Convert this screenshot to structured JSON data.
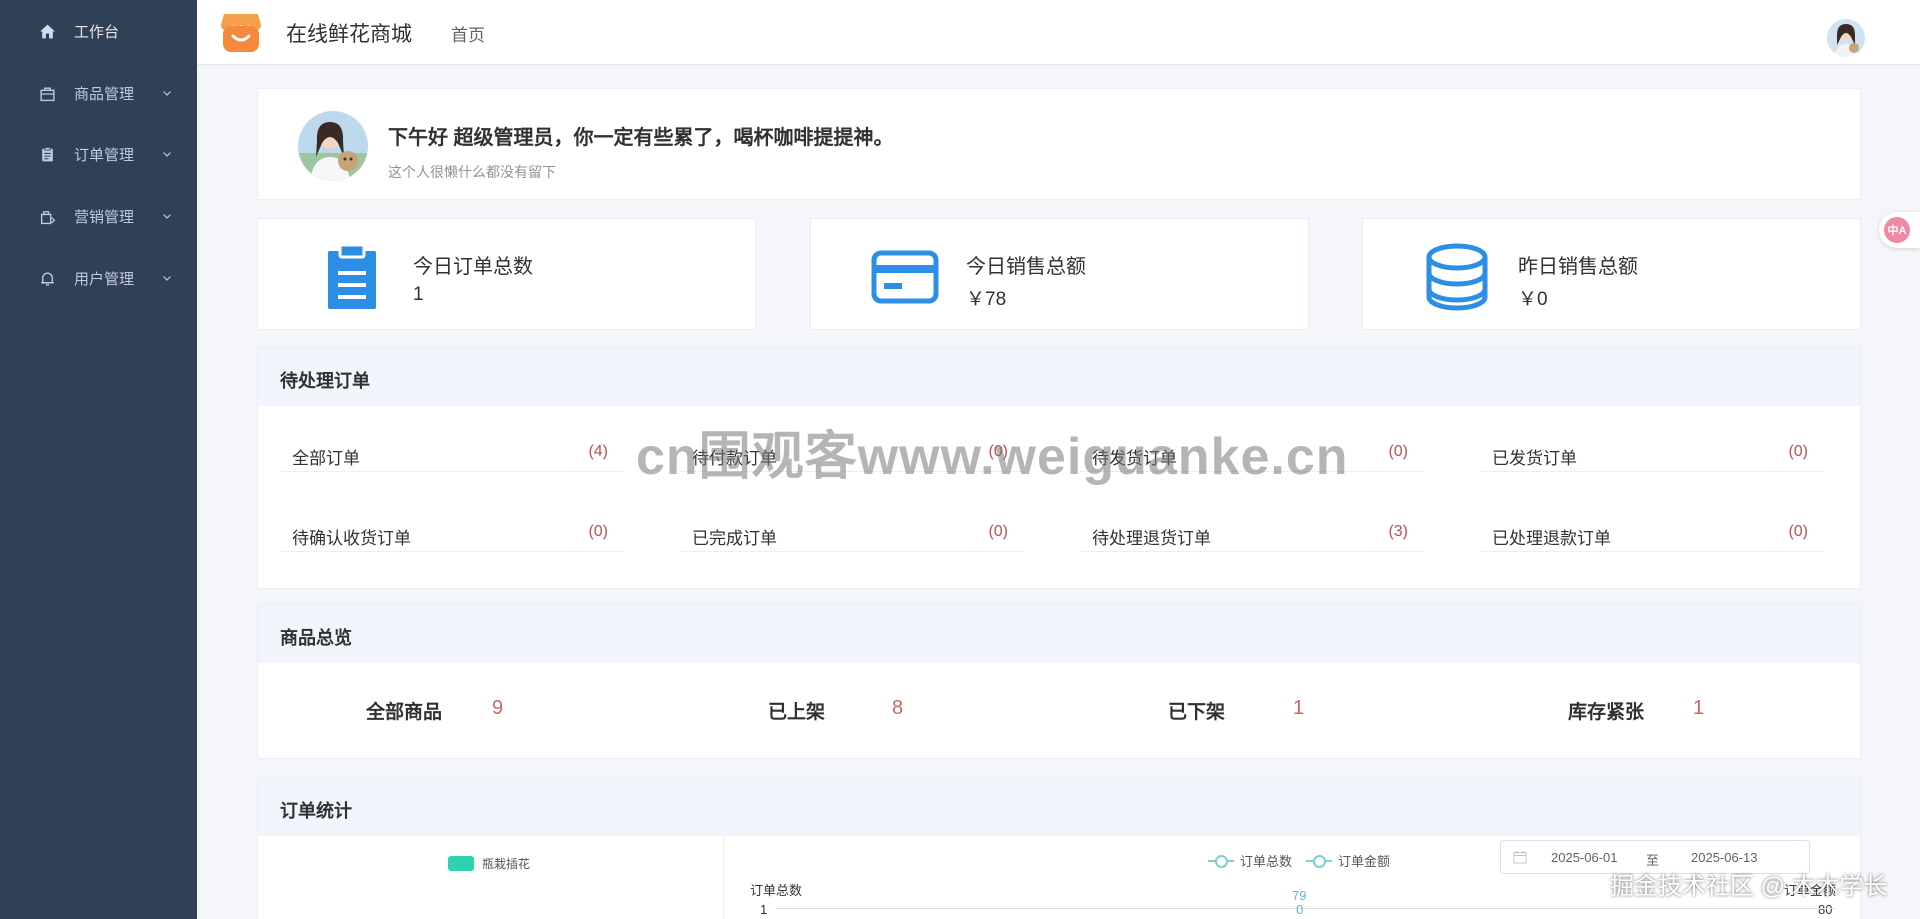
{
  "sidebar": {
    "items": [
      {
        "label": "工作台",
        "icon": "home-icon",
        "active": true
      },
      {
        "label": "商品管理",
        "icon": "bag-icon"
      },
      {
        "label": "订单管理",
        "icon": "clipboard-icon"
      },
      {
        "label": "营销管理",
        "icon": "gift-icon"
      },
      {
        "label": "用户管理",
        "icon": "bell-icon"
      }
    ]
  },
  "header": {
    "brand": "在线鲜花商城",
    "nav_home": "首页"
  },
  "welcome": {
    "title": "下午好 超级管理员，你一定有些累了，喝杯咖啡提提神。",
    "subtitle": "这个人很懒什么都没有留下"
  },
  "stats": [
    {
      "label": "今日订单总数",
      "value": "1",
      "icon": "clipboard-icon"
    },
    {
      "label": "今日销售总额",
      "value": "￥78",
      "icon": "card-icon"
    },
    {
      "label": "昨日销售总额",
      "value": "￥0",
      "icon": "coins-icon"
    }
  ],
  "pending": {
    "title": "待处理订单",
    "items": [
      {
        "label": "全部订单",
        "count": "(4)"
      },
      {
        "label": "待付款订单",
        "count": "(0)"
      },
      {
        "label": "待发货订单",
        "count": "(0)"
      },
      {
        "label": "已发货订单",
        "count": "(0)"
      },
      {
        "label": "待确认收货订单",
        "count": "(0)"
      },
      {
        "label": "已完成订单",
        "count": "(0)"
      },
      {
        "label": "待处理退货订单",
        "count": "(3)"
      },
      {
        "label": "已处理退款订单",
        "count": "(0)"
      }
    ]
  },
  "overview": {
    "title": "商品总览",
    "items": [
      {
        "label": "全部商品",
        "value": "9"
      },
      {
        "label": "已上架",
        "value": "8"
      },
      {
        "label": "已下架",
        "value": "1"
      },
      {
        "label": "库存紧张",
        "value": "1"
      }
    ]
  },
  "order_stats": {
    "title": "订单统计",
    "pie_legend": "瓶栽插花",
    "legend_total": "订单总数",
    "legend_amount": "订单金额",
    "date_start": "2025-06-01",
    "date_sep": "至",
    "date_end": "2025-06-13",
    "y_left_label": "订单总数",
    "y_left_tick": "1",
    "y_right_label": "订单金额",
    "y_right_tick": "80",
    "point_label_1": "79",
    "point_label_2": "0"
  },
  "watermark": "cn围观客www.weiguanke.cn",
  "corner_watermark": "掘金技术社区 @ 木木学长",
  "colors": {
    "sidebar_bg": "#304156",
    "accent_blue": "#2d8ee6",
    "count_red": "#c0504d",
    "legend_teal": "#2ed2b0"
  }
}
